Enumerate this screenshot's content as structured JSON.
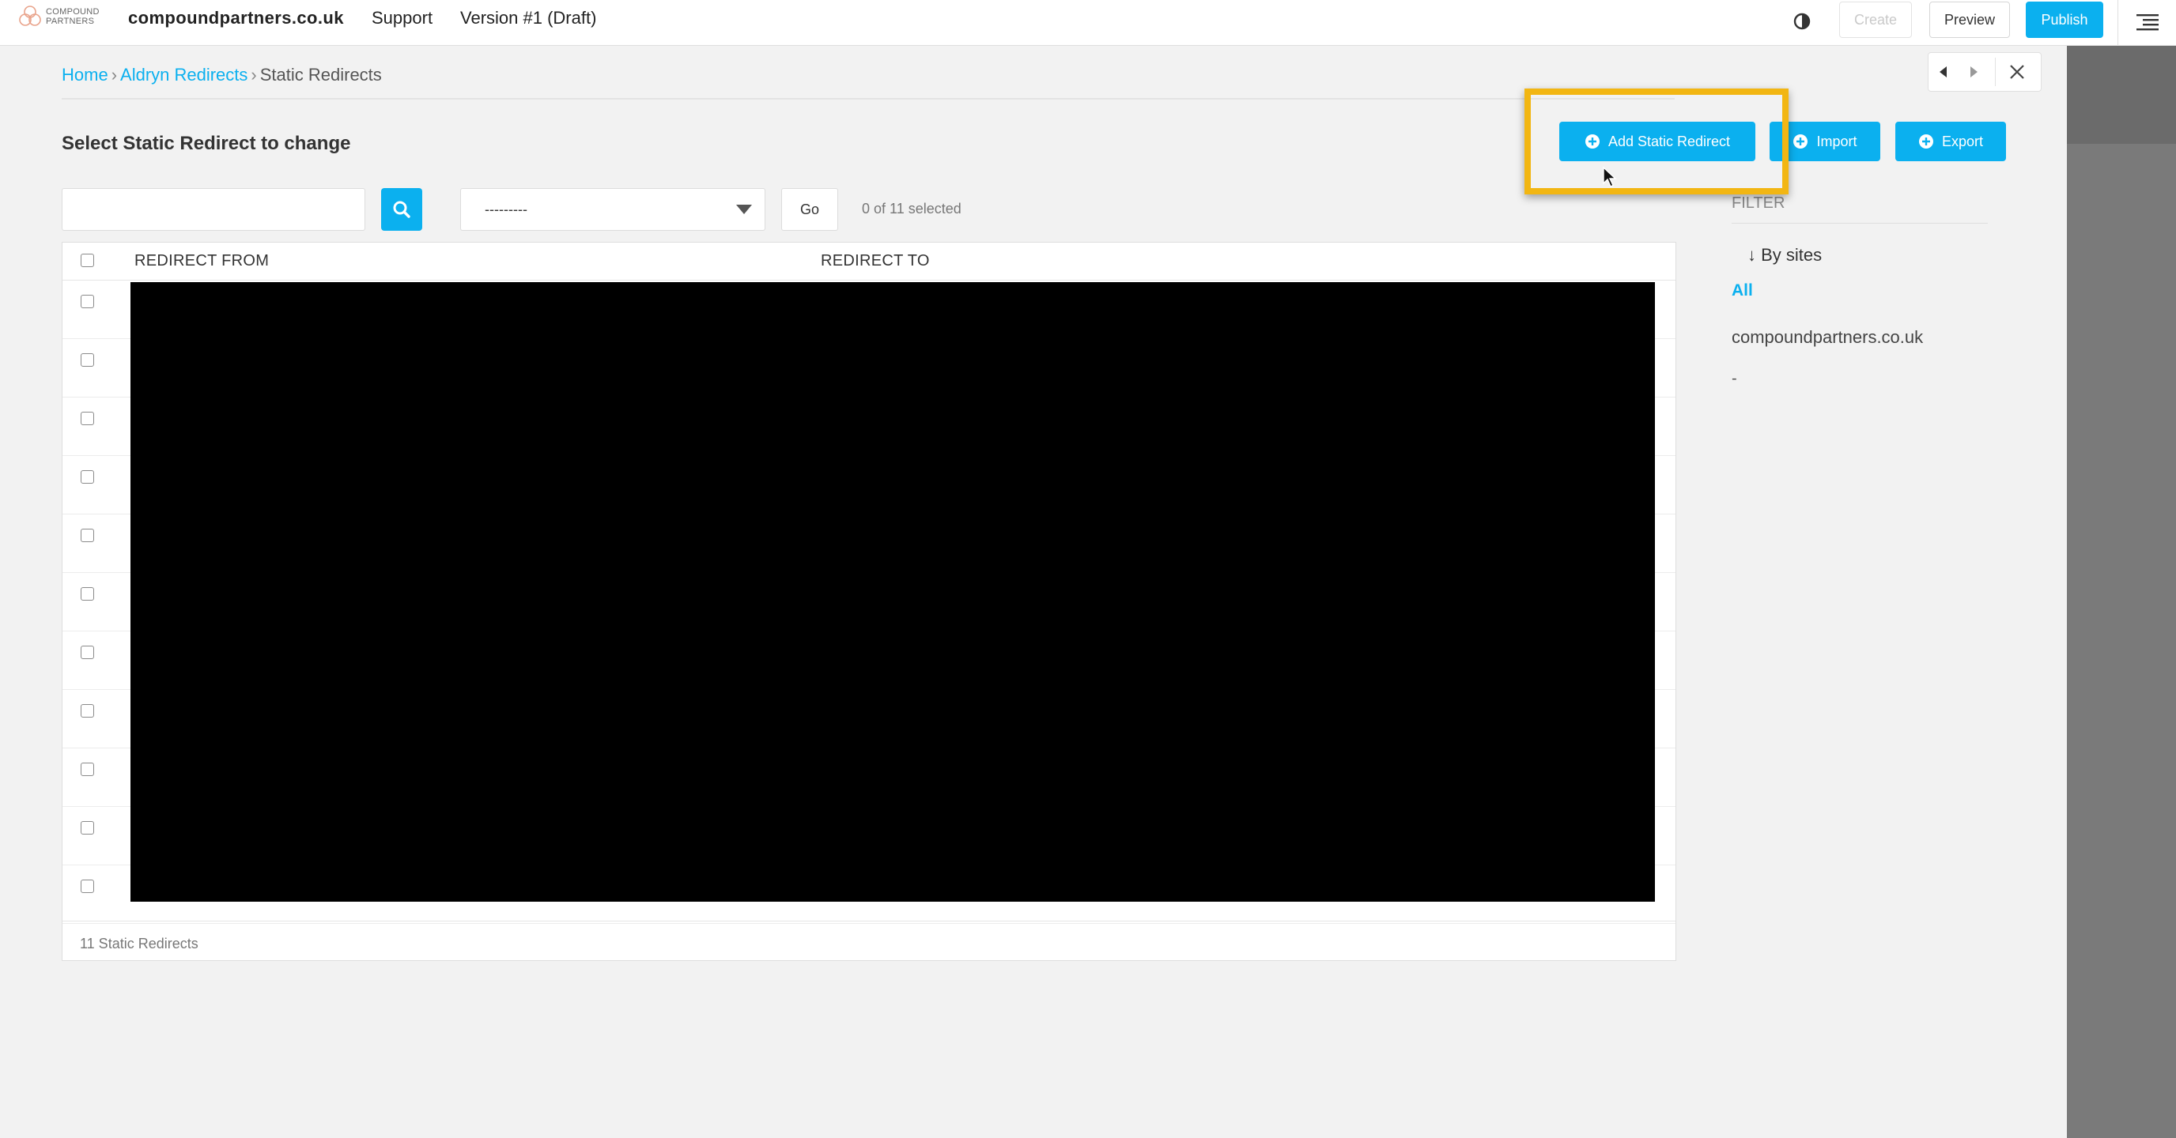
{
  "toolbar": {
    "logo_line1": "COMPOUND",
    "logo_line2": "PARTNERS",
    "site_name": "compoundpartners.co.uk",
    "support": "Support",
    "version": "Version #1 (Draft)",
    "create": "Create",
    "preview": "Preview",
    "publish": "Publish",
    "icons": [
      "contrast-icon",
      "structure-menu-icon"
    ]
  },
  "panel_controls": {
    "icons": [
      "arrow-left-icon",
      "arrow-right-icon",
      "close-icon"
    ]
  },
  "breadcrumb": {
    "home": "Home",
    "app": "Aldryn Redirects",
    "current": "Static Redirects",
    "separator": "›"
  },
  "page": {
    "title": "Select Static Redirect to change"
  },
  "object_tools": {
    "add": "Add Static Redirect",
    "import": "Import",
    "export": "Export"
  },
  "actions": {
    "search_value": "",
    "select_value": "---------",
    "go": "Go",
    "selected_count": "0 of 11 selected"
  },
  "filter": {
    "title": "FILTER",
    "by": "↓ By sites",
    "options": [
      "All",
      "compoundpartners.co.uk",
      "-"
    ]
  },
  "table": {
    "columns": [
      "REDIRECT FROM",
      "REDIRECT TO"
    ],
    "row_count": 11,
    "footer": "11 Static Redirects"
  },
  "colors": {
    "accent": "#0bb0ef",
    "highlight": "#f2b613",
    "background": "#f2f2f2"
  }
}
